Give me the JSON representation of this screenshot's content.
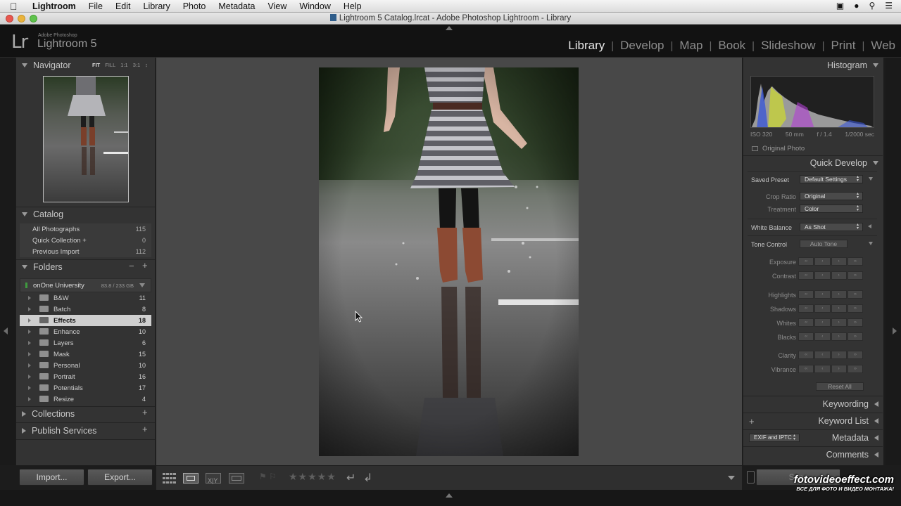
{
  "menubar": {
    "app": "Lightroom",
    "items": [
      "File",
      "Edit",
      "Library",
      "Photo",
      "Metadata",
      "View",
      "Window",
      "Help"
    ]
  },
  "window": {
    "title": "Lightroom 5 Catalog.lrcat - Adobe Photoshop Lightroom - Library"
  },
  "identity": {
    "logo": "Lr",
    "vendor": "Adobe Photoshop",
    "product": "Lightroom 5"
  },
  "modules": [
    "Library",
    "Develop",
    "Map",
    "Book",
    "Slideshow",
    "Print",
    "Web"
  ],
  "navigator": {
    "title": "Navigator",
    "options": [
      "FIT",
      "FILL",
      "1:1",
      "3:1"
    ]
  },
  "catalog": {
    "title": "Catalog",
    "items": [
      {
        "label": "All Photographs",
        "count": "115"
      },
      {
        "label": "Quick Collection +",
        "count": "0"
      },
      {
        "label": "Previous Import",
        "count": "112"
      }
    ]
  },
  "folders": {
    "title": "Folders",
    "volume": {
      "name": "onOne University",
      "size": "83.8 / 233 GB"
    },
    "items": [
      {
        "label": "B&W",
        "count": "11"
      },
      {
        "label": "Batch",
        "count": "8"
      },
      {
        "label": "Effects",
        "count": "18"
      },
      {
        "label": "Enhance",
        "count": "10"
      },
      {
        "label": "Layers",
        "count": "6"
      },
      {
        "label": "Mask",
        "count": "15"
      },
      {
        "label": "Personal",
        "count": "10"
      },
      {
        "label": "Portrait",
        "count": "16"
      },
      {
        "label": "Potentials",
        "count": "17"
      },
      {
        "label": "Resize",
        "count": "4"
      }
    ]
  },
  "collections": {
    "title": "Collections"
  },
  "publish": {
    "title": "Publish Services"
  },
  "buttons": {
    "import": "Import...",
    "export": "Export..."
  },
  "histogram": {
    "title": "Histogram",
    "iso": "ISO 320",
    "focal": "50 mm",
    "aperture": "f / 1.4",
    "shutter": "1/2000 sec",
    "original_photo": "Original Photo"
  },
  "quick_develop": {
    "title": "Quick Develop",
    "saved_preset_label": "Saved Preset",
    "saved_preset_value": "Default Settings",
    "crop_ratio_label": "Crop Ratio",
    "crop_ratio_value": "Original",
    "treatment_label": "Treatment",
    "treatment_value": "Color",
    "white_balance_label": "White Balance",
    "white_balance_value": "As Shot",
    "tone_control_label": "Tone Control",
    "auto_tone": "Auto Tone",
    "exposure": "Exposure",
    "contrast": "Contrast",
    "highlights": "Highlights",
    "shadows": "Shadows",
    "whites": "Whites",
    "blacks": "Blacks",
    "clarity": "Clarity",
    "vibrance": "Vibrance",
    "reset_all": "Reset All"
  },
  "right_sections": {
    "keywording": "Keywording",
    "keyword_list": "Keyword List",
    "metadata": "Metadata",
    "metadata_preset": "EXIF and IPTC",
    "comments": "Comments"
  },
  "sync": {
    "label": "Sync"
  },
  "watermark": {
    "line1": "fotovideoeffect.com",
    "line2": "ВСЕ ДЛЯ ФОТО И ВИДЕО МОНТАЖА!"
  }
}
